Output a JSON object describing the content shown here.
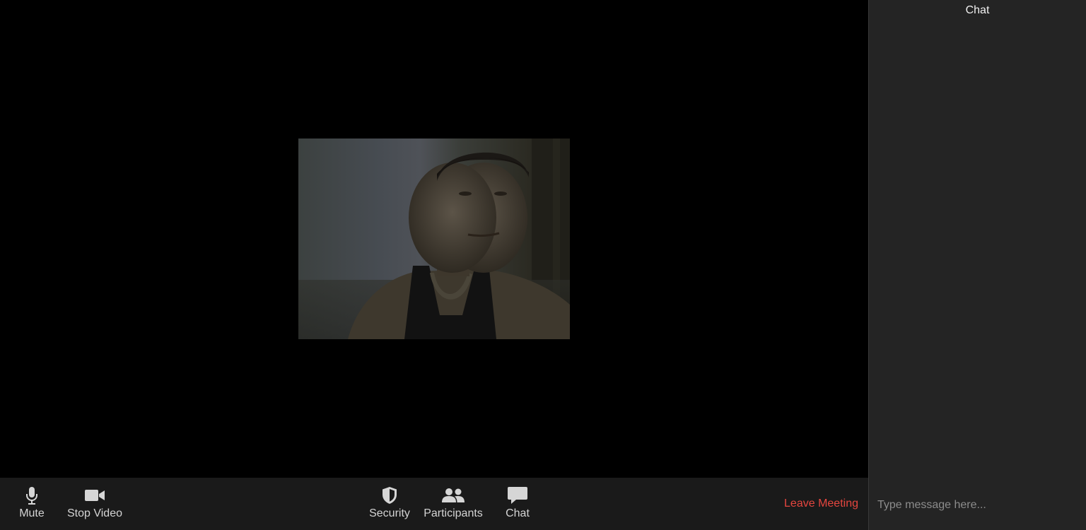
{
  "toolbar": {
    "mute_label": "Mute",
    "stop_video_label": "Stop Video",
    "security_label": "Security",
    "participants_label": "Participants",
    "chat_label": "Chat",
    "leave_label": "Leave Meeting",
    "icons": {
      "mute": "microphone-icon",
      "stop_video": "video-camera-icon",
      "security": "shield-icon",
      "participants": "people-icon",
      "chat": "speech-bubble-icon"
    }
  },
  "chat_panel": {
    "title": "Chat",
    "input_placeholder": "Type message here..."
  },
  "colors": {
    "toolbar_bg": "#1a1a1a",
    "panel_bg": "#242424",
    "leave_red": "#e5463f",
    "icon_gray": "#d6d6d6"
  }
}
